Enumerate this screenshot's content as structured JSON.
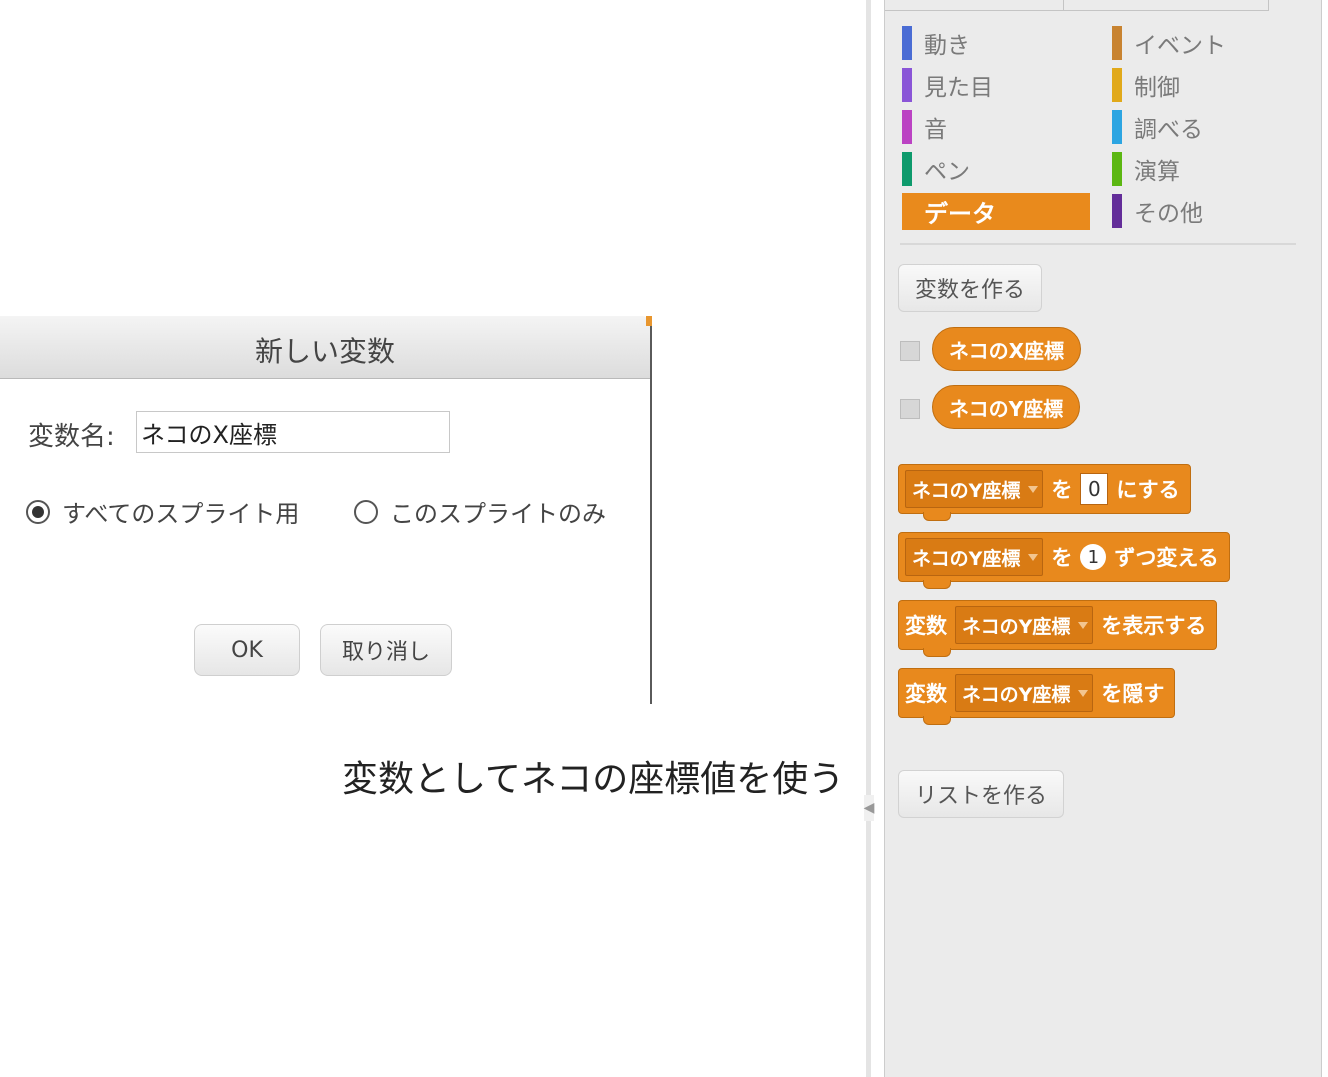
{
  "dialog": {
    "title": "新しい変数",
    "name_label": "変数名:",
    "name_value": "ネコのX座標",
    "radio_all": "すべてのスプライト用",
    "radio_this": "このスプライトのみ",
    "ok": "OK",
    "cancel": "取り消し"
  },
  "caption": "変数としてネコの座標値を使う",
  "palette": {
    "categories": [
      {
        "label": "動き",
        "color": "#4a6cd4"
      },
      {
        "label": "見た目",
        "color": "#8a55d7"
      },
      {
        "label": "音",
        "color": "#bb42c3"
      },
      {
        "label": "ペン",
        "color": "#0e9a6c"
      },
      {
        "label": "データ",
        "color": "#ee7d16"
      },
      {
        "label": "イベント",
        "color": "#c88330"
      },
      {
        "label": "制御",
        "color": "#e1a91a"
      },
      {
        "label": "調べる",
        "color": "#2ca5e2"
      },
      {
        "label": "演算",
        "color": "#5cb712"
      },
      {
        "label": "その他",
        "color": "#632d99"
      }
    ],
    "selected": "データ",
    "make_variable": "変数を作る",
    "variables": [
      "ネコのX座標",
      "ネコのY座標"
    ],
    "blocks": {
      "set": {
        "var": "ネコのY座標",
        "to": "を",
        "value": "0",
        "suffix": "にする"
      },
      "change": {
        "var": "ネコのY座標",
        "to": "を",
        "value": "1",
        "suffix": "ずつ変える"
      },
      "show": {
        "prefix": "変数",
        "var": "ネコのY座標",
        "suffix": "を表示する"
      },
      "hide": {
        "prefix": "変数",
        "var": "ネコのY座標",
        "suffix": "を隠す"
      }
    },
    "make_list": "リストを作る"
  },
  "colors": {
    "data_orange": "#e8891d",
    "data_selected": "#e98a1c"
  }
}
